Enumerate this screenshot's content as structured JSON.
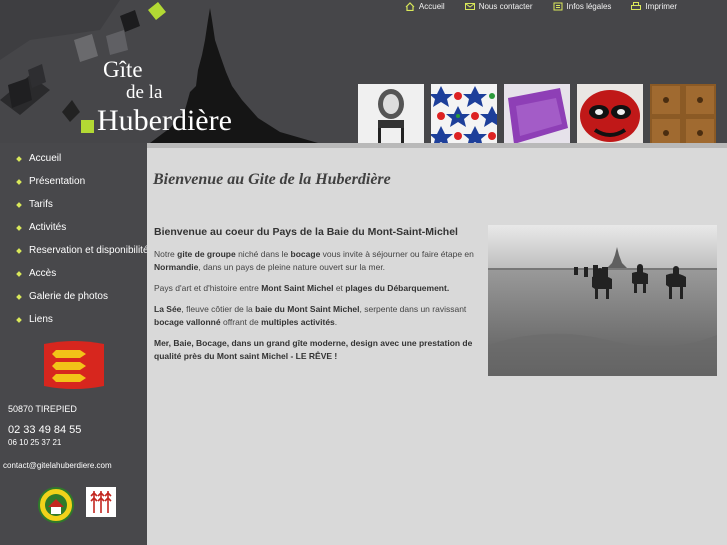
{
  "topnav": {
    "home": "Accueil",
    "contact": "Nous contacter",
    "legal": "Infos légales",
    "print": "Imprimer"
  },
  "logo": {
    "line1": "Gîte",
    "line2": "de la",
    "line3": "Huberdière"
  },
  "menu": [
    {
      "label": "Accueil"
    },
    {
      "label": "Présentation"
    },
    {
      "label": "Tarifs"
    },
    {
      "label": "Activités"
    },
    {
      "label": "Reservation et disponibilité"
    },
    {
      "label": "Accès"
    },
    {
      "label": "Galerie de photos"
    },
    {
      "label": "Liens"
    }
  ],
  "contact": {
    "city": "50870 TIREPIED",
    "phone": "02 33 49 84 55",
    "mobile": "06 10 25 37 21",
    "email": "contact@gitelahuberdiere.com"
  },
  "main": {
    "title": "Bienvenue au Gite de la Huberdière",
    "subtitle": "Bienvenue au coeur du Pays de la Baie du Mont-Saint-Michel",
    "p1": {
      "a": "Notre ",
      "b": "gite de groupe",
      "c": " niché dans le ",
      "d": "bocage",
      "e": " vous invite à séjourner ou faire étape en ",
      "f": "Normandie",
      "g": ", dans un pays de pleine nature ouvert sur la mer."
    },
    "p2": {
      "a": "Pays d'art et d'histoire entre ",
      "b": "Mont Saint Michel",
      "c": " et ",
      "d": "plages du Débarquement."
    },
    "p3": {
      "a": "La Sée",
      "b": ", fleuve côtier de la ",
      "c": "baie du Mont Saint Michel",
      "d": ", serpente dans un ravissant ",
      "e": "bocage vallonné",
      "f": " offrant de ",
      "g": "multiples activités",
      "h": "."
    },
    "p4": "Mer, Baie, Bocage, dans un grand gîte moderne, design avec une prestation de qualité près du Mont saint Michel - LE RÊVE !"
  },
  "colors": {
    "accent": "#b3d934",
    "sidebar": "#48484b",
    "content_bg": "#d9d9d9"
  },
  "icons": [
    "home-icon",
    "mail-icon",
    "info-icon",
    "print-icon"
  ]
}
